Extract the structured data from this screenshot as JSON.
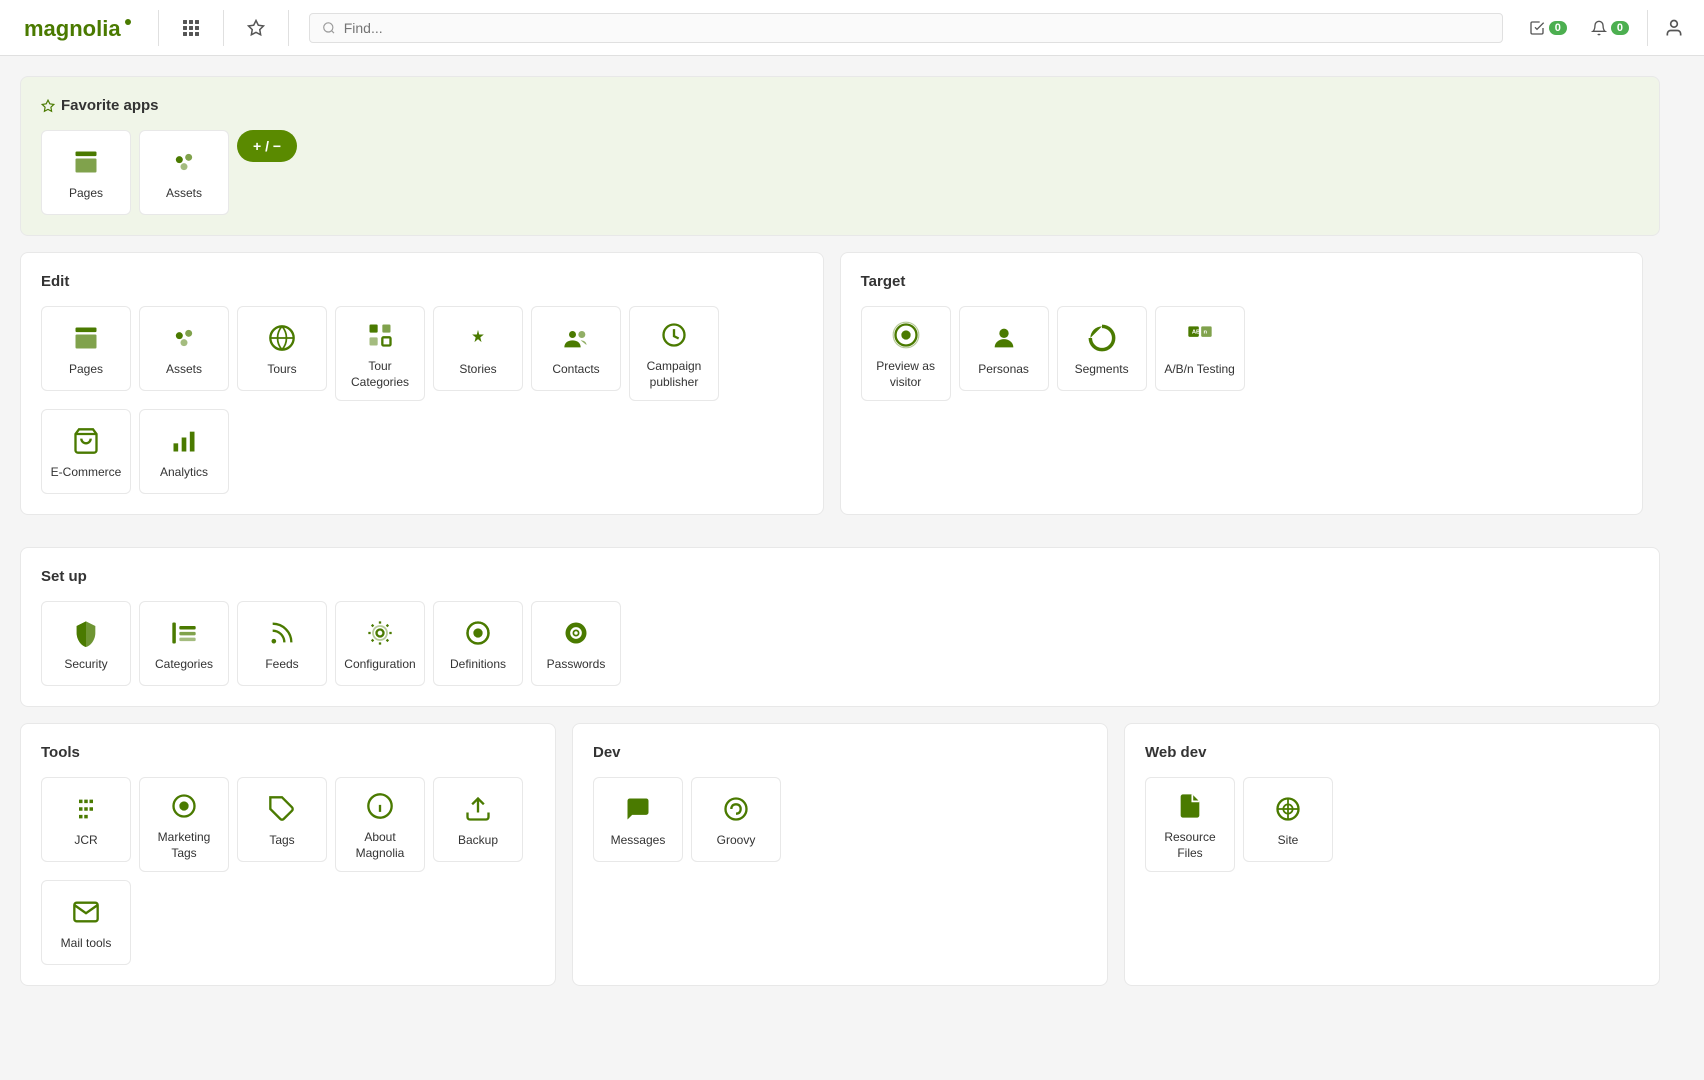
{
  "header": {
    "logo": "magnolia",
    "search_placeholder": "Find...",
    "tasks_count": "0",
    "notifications_count": "0"
  },
  "favorites": {
    "title": "Favorite apps",
    "apps": [
      {
        "id": "pages",
        "label": "Pages",
        "icon": "pages"
      },
      {
        "id": "assets",
        "label": "Assets",
        "icon": "assets"
      }
    ],
    "add_remove_label": "+ / −"
  },
  "edit": {
    "title": "Edit",
    "apps": [
      {
        "id": "pages",
        "label": "Pages",
        "icon": "pages"
      },
      {
        "id": "assets",
        "label": "Assets",
        "icon": "assets"
      },
      {
        "id": "tours",
        "label": "Tours",
        "icon": "tours"
      },
      {
        "id": "tour-categories",
        "label": "Tour Categories",
        "icon": "tour-categories"
      },
      {
        "id": "stories",
        "label": "Stories",
        "icon": "stories"
      },
      {
        "id": "contacts",
        "label": "Contacts",
        "icon": "contacts"
      },
      {
        "id": "campaign-publisher",
        "label": "Campaign publisher",
        "icon": "campaign-publisher"
      },
      {
        "id": "ecommerce",
        "label": "E-Commerce",
        "icon": "ecommerce"
      },
      {
        "id": "analytics",
        "label": "Analytics",
        "icon": "analytics"
      }
    ]
  },
  "target": {
    "title": "Target",
    "apps": [
      {
        "id": "preview-as-visitor",
        "label": "Preview as visitor",
        "icon": "preview-as-visitor"
      },
      {
        "id": "personas",
        "label": "Personas",
        "icon": "personas"
      },
      {
        "id": "segments",
        "label": "Segments",
        "icon": "segments"
      },
      {
        "id": "abn-testing",
        "label": "A/B/n Testing",
        "icon": "abn-testing"
      }
    ]
  },
  "setup": {
    "title": "Set up",
    "apps": [
      {
        "id": "security",
        "label": "Security",
        "icon": "security"
      },
      {
        "id": "categories",
        "label": "Categories",
        "icon": "categories"
      },
      {
        "id": "feeds",
        "label": "Feeds",
        "icon": "feeds"
      },
      {
        "id": "configuration",
        "label": "Configuration",
        "icon": "configuration"
      },
      {
        "id": "definitions",
        "label": "Definitions",
        "icon": "definitions"
      },
      {
        "id": "passwords",
        "label": "Passwords",
        "icon": "passwords"
      }
    ]
  },
  "tools": {
    "title": "Tools",
    "apps": [
      {
        "id": "jcr",
        "label": "JCR",
        "icon": "jcr"
      },
      {
        "id": "marketing-tags",
        "label": "Marketing Tags",
        "icon": "marketing-tags"
      },
      {
        "id": "tags",
        "label": "Tags",
        "icon": "tags"
      },
      {
        "id": "about-magnolia",
        "label": "About Magnolia",
        "icon": "about-magnolia"
      },
      {
        "id": "backup",
        "label": "Backup",
        "icon": "backup"
      },
      {
        "id": "mail-tools",
        "label": "Mail tools",
        "icon": "mail-tools"
      }
    ]
  },
  "dev": {
    "title": "Dev",
    "apps": [
      {
        "id": "messages",
        "label": "Messages",
        "icon": "messages"
      },
      {
        "id": "groovy",
        "label": "Groovy",
        "icon": "groovy"
      }
    ]
  },
  "webdev": {
    "title": "Web dev",
    "apps": [
      {
        "id": "resource-files",
        "label": "Resource Files",
        "icon": "resource-files"
      },
      {
        "id": "site",
        "label": "Site",
        "icon": "site"
      }
    ]
  }
}
